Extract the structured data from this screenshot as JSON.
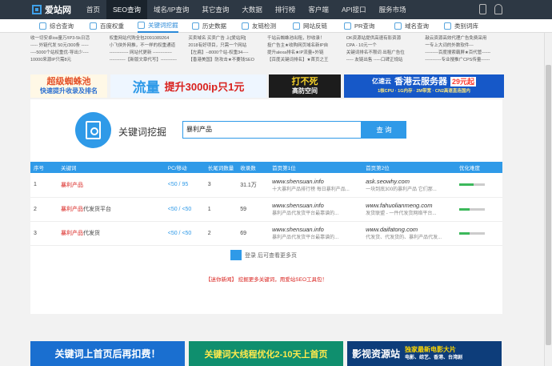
{
  "nav": {
    "logo": "爱站网",
    "items": [
      "首页",
      "SEO查询",
      "域名/IP查询",
      "其它查询",
      "大数据",
      "排行榜",
      "客户端",
      "API接口",
      "服务市场"
    ],
    "active_index": 1
  },
  "tabs": [
    "综合查询",
    "百度权重",
    "关键词挖掘",
    "历史数据",
    "友链检测",
    "网站反链",
    "PR查询",
    "域名查询",
    "类别词库"
  ],
  "links": [
    [
      "收一切安卓ios量万/IP3-5k日活",
      "----- 外链代发 50元/300条 -----",
      "----5000个站权重优-导出少----",
      "10000来源IP只需8元"
    ],
    [
      "权重网站代购全包2091089264",
      "小飞侠外网推，不一样的权重通道",
      "------------- 网站代更新 -------------",
      "-----------【新版文章代写】-----------"
    ],
    [
      "买卖域名 买卖广告 上[爱站网]",
      "2018有好项目，只需一个网站",
      "【左扁】--8000个站-权重34----",
      "【香港美国】防攻击★不要钱SEO"
    ],
    [
      "千站云蜘蛛池出租，秒收录！",
      "投广告主★收购网页域名新IP自",
      "提升alexa排名★IP流量+外链",
      "【百度关键词排名】★首页之王"
    ],
    [
      "OK资源站提供高速有影资源",
      "CPA - 10元一个",
      "关键词排名不限词 出租广告位",
      "----- 友链出售 -----口碑正规站"
    ],
    [
      "敲云资源高效代理广告免费采用",
      "一专上大词的外数软件---",
      "---------百度搜索霸屏★百代管------",
      "-----------专业搜推广CPS传量------"
    ]
  ],
  "banners": [
    "超级蜘蛛池",
    "快速提升收录及排名",
    "流量",
    "提升3000ip只1元",
    "打不死",
    "高防空间",
    "亿速云",
    "香港云服务器",
    "29元起",
    "1核CPU · 1G内存 · 2M带宽 · CN2高速直连国内"
  ],
  "search": {
    "title": "关键词挖掘",
    "value": "暴利产品",
    "button": "查 询"
  },
  "table": {
    "headers": [
      "序号",
      "关键词",
      "PC/移动",
      "长尾词数量",
      "收录数",
      "首页第1位",
      "首页第2位",
      "优化难度"
    ],
    "rows": [
      {
        "no": "1",
        "kw_hl": "暴利产品",
        "kw_rest": "",
        "index": "<50 / 95",
        "long": "3",
        "count": "31.1万",
        "url1": "www.shensuan.info",
        "desc1": "十大暴利产品排行榜 每日暴利产品...",
        "url2": "ask.seowhy.com",
        "desc2": "一块到底300的暴利产品 它们那...",
        "difficulty": 0.55
      },
      {
        "no": "2",
        "kw_hl": "暴利产品",
        "kw_rest": "代发货平台",
        "index": "<50 / <50",
        "long": "1",
        "count": "59",
        "url1": "www.shensuan.info",
        "desc1": "暴利产品代发货平台最靠谱的...",
        "url2": "www.fahuolianmeng.com",
        "desc2": "发货联盟 - 一件代发货网络平台...",
        "difficulty": 0.4
      },
      {
        "no": "3",
        "kw_hl": "暴利产品",
        "kw_rest": "代发货",
        "index": "<50 / <50",
        "long": "2",
        "count": "69",
        "url1": "www.shensuan.info",
        "desc1": "暴利产品代发货平台最靠谱的...",
        "url2": "www.daifatong.com",
        "desc2": "代发货、代发货的、暴利产品代发...",
        "difficulty": 0.4
      }
    ]
  },
  "more": "登录 后可查看更多页",
  "notice": "【迷你新闻】 挖掘更多关键词，用爱站SEO工具包！",
  "bottom_banners": [
    "关键词上首页后再扣费！",
    "关键词大线程优化2-10天上首页",
    "影视资源站",
    "独家最新电影大片",
    "电影、综艺、香港、台湾剧"
  ],
  "colors": {
    "accent": "#2f9ae8",
    "nav_bg": "#2d3844",
    "red": "#d9211d"
  }
}
